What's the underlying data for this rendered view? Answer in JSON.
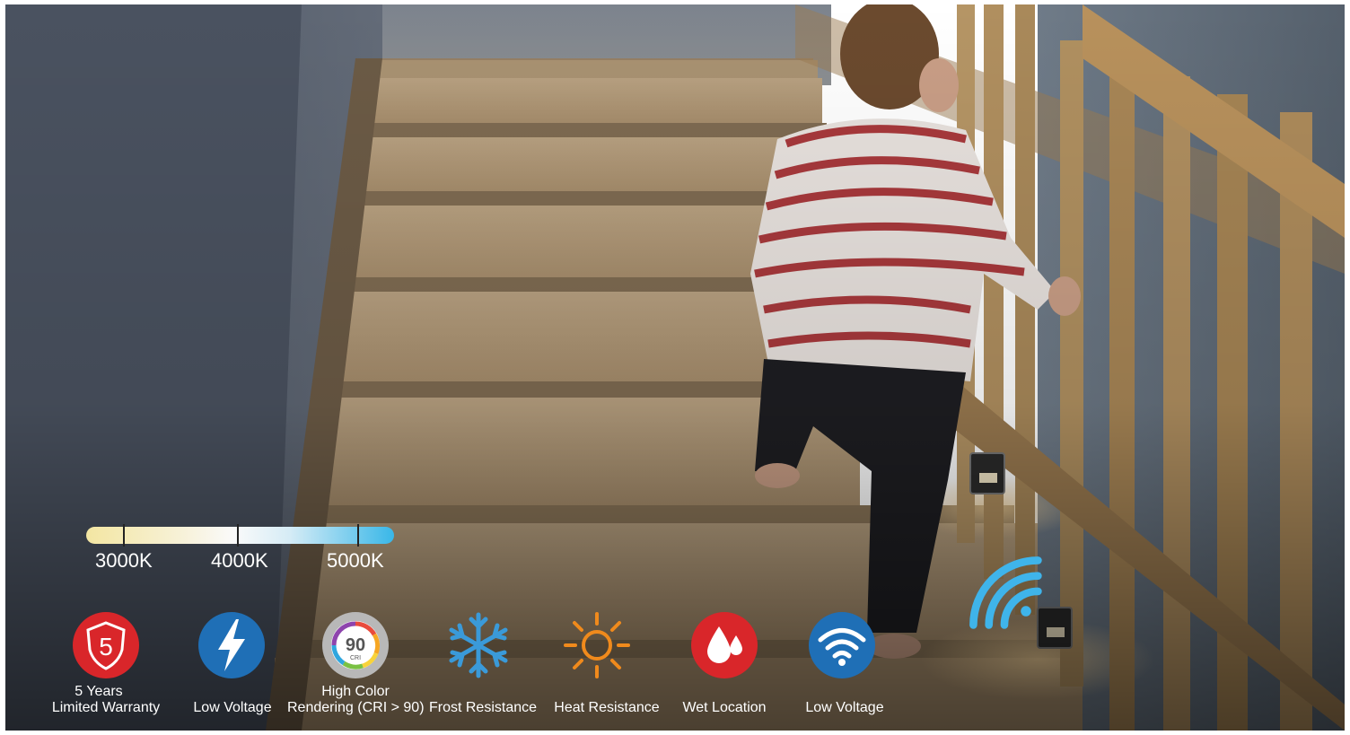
{
  "color_scale": {
    "stops": [
      "3000K",
      "4000K",
      "5000K"
    ],
    "gradient_colors": [
      "#f3e6a2",
      "#fafafa",
      "#39b7e8"
    ]
  },
  "cri_badge": {
    "value": "90",
    "sub": "CRI"
  },
  "warranty_badge": {
    "value": "5"
  },
  "features": [
    {
      "icon": "warranty-shield-icon",
      "label_line1": "5 Years",
      "label_line2": "Limited Warranty",
      "color": "#d9262a"
    },
    {
      "icon": "lightning-bolt-icon",
      "label_line1": "",
      "label_line2": "Low Voltage",
      "color": "#1f6fb6"
    },
    {
      "icon": "cri-badge-icon",
      "label_line1": "High Color",
      "label_line2": "Rendering (CRI > 90)",
      "color": "#b8b8b8"
    },
    {
      "icon": "snowflake-icon",
      "label_line1": "",
      "label_line2": "Frost Resistance",
      "color": "#3a9ad9"
    },
    {
      "icon": "sun-icon",
      "label_line1": "",
      "label_line2": "Heat Resistance",
      "color": "#f08a1c"
    },
    {
      "icon": "water-drops-icon",
      "label_line1": "",
      "label_line2": "Wet Location",
      "color": "#d9262a"
    },
    {
      "icon": "wifi-icon",
      "label_line1": "",
      "label_line2": "Low Voltage",
      "color": "#1f6fb6"
    }
  ],
  "wireless_signal": {
    "icon": "wireless-signal-icon",
    "color": "#3fb4ea"
  }
}
